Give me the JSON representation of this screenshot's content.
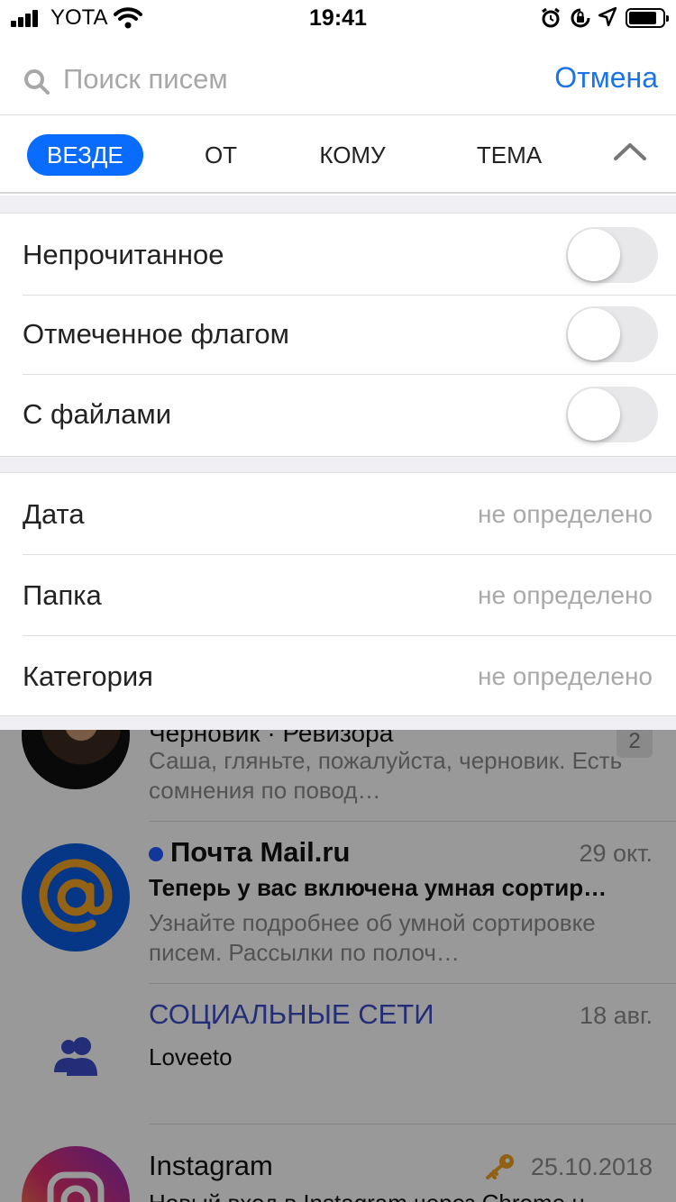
{
  "status_bar": {
    "carrier": "YOTA",
    "time": "19:41"
  },
  "search": {
    "placeholder": "Поиск писем",
    "value": "",
    "cancel_label": "Отмена"
  },
  "filter_tabs": [
    {
      "label": "ВЕЗДЕ",
      "active": true
    },
    {
      "label": "ОТ",
      "active": false
    },
    {
      "label": "КОМУ",
      "active": false
    },
    {
      "label": "ТЕМА",
      "active": false
    }
  ],
  "toggles": [
    {
      "label": "Непрочитанное",
      "on": false
    },
    {
      "label": "Отмеченное флагом",
      "on": false
    },
    {
      "label": "С файлами",
      "on": false
    }
  ],
  "filters": [
    {
      "label": "Дата",
      "value": "не определено"
    },
    {
      "label": "Папка",
      "value": "не определено"
    },
    {
      "label": "Категория",
      "value": "не определено"
    }
  ],
  "messages": [
    {
      "from": "Черновик · Ревизора",
      "snippet": "Саша, гляньте, пожалуйста, черновик. Есть сомнения по повод…",
      "count": "2"
    },
    {
      "from": "Почта Mail.ru",
      "date": "29 окт.",
      "subject": "Теперь у вас включена умная сортир…",
      "snippet": "Узнайте подробнее об умной сортировке писем. Рассылки по полоч…",
      "unread": true
    },
    {
      "from": "СОЦИАЛЬНЫЕ СЕТИ",
      "date": "18 авг.",
      "subject": "Loveeto"
    },
    {
      "from": "Instagram",
      "date": "25.10.2018",
      "subject": "Новый вход в Instagram через Chrome н…"
    }
  ],
  "colors": {
    "accent": "#0a6cff",
    "link": "#1a73e8",
    "group_bg": "#efeff4",
    "social": "#3d4cc8",
    "mail_ru_orange": "#f5a623"
  }
}
